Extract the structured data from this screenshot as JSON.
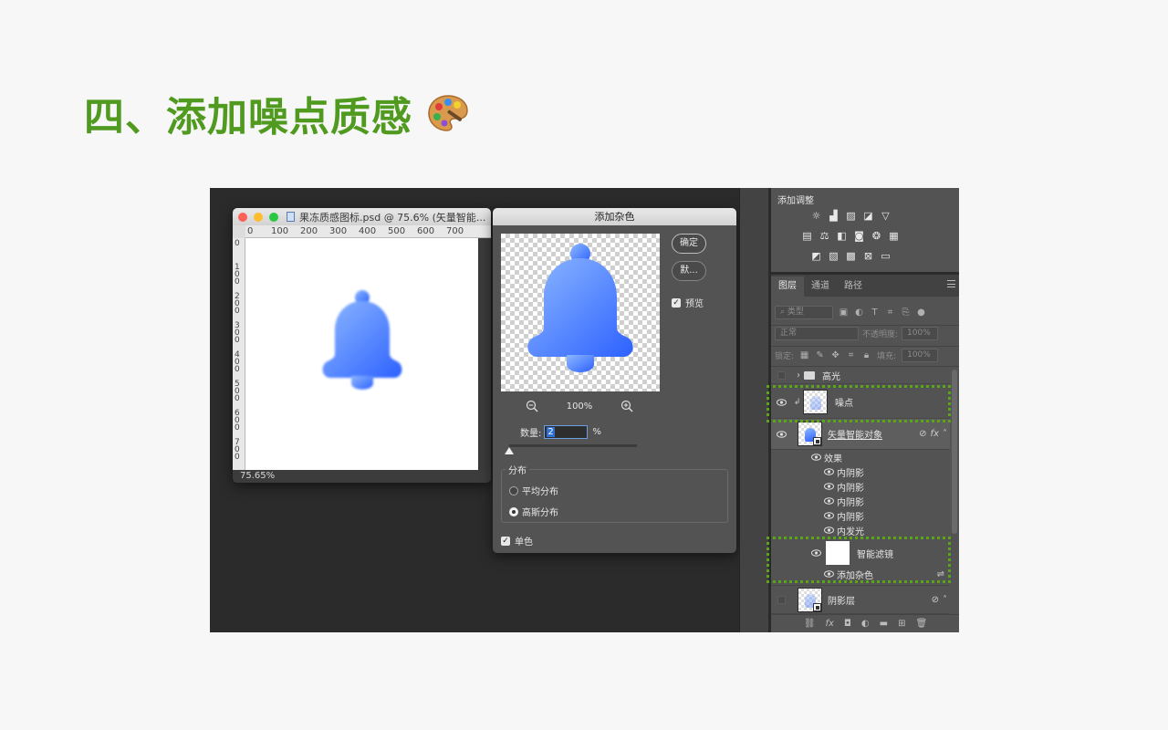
{
  "slide": {
    "title": "四、添加噪点质感",
    "title_color": "#4f9a1f",
    "title_icon": "artist-palette-icon"
  },
  "document": {
    "title": "果冻质感图标.psd @ 75.6% (矢量智能...",
    "zoom_status": "75.65%",
    "ruler_top": [
      "0",
      "100",
      "200",
      "300",
      "400",
      "500",
      "600",
      "700"
    ],
    "ruler_left": [
      "0",
      "100",
      "200",
      "300",
      "400",
      "500",
      "600",
      "700"
    ],
    "bell_gradient": [
      "#8db8ff",
      "#2d61ff"
    ]
  },
  "dialog": {
    "title": "添加杂色",
    "ok_label": "确定",
    "default_label": "默...",
    "preview_label": "预览",
    "preview_checked": true,
    "zoom_value": "100%",
    "amount_label": "数量:",
    "amount_value": "2",
    "amount_unit": "%",
    "distribution_label": "分布",
    "uniform_label": "平均分布",
    "gaussian_label": "高斯分布",
    "selected_distribution": "高斯分布",
    "mono_label": "单色",
    "mono_checked": true
  },
  "adjustments": {
    "title": "添加调整",
    "row1_icons": [
      "brightness-contrast-icon",
      "levels-icon",
      "curves-icon",
      "exposure-icon",
      "vibrance-icon"
    ],
    "row2_icons": [
      "hue-saturation-icon",
      "color-balance-icon",
      "black-white-icon",
      "photo-filter-icon",
      "channel-mixer-icon",
      "color-lookup-icon"
    ],
    "row3_icons": [
      "invert-icon",
      "posterize-icon",
      "threshold-icon",
      "selective-color-icon",
      "gradient-map-icon"
    ]
  },
  "layers_panel": {
    "tabs": [
      "图层",
      "通道",
      "路径"
    ],
    "active_tab": "图层",
    "filter_kind": "类型",
    "blend_mode": "正常",
    "opacity_label": "不透明度:",
    "opacity_value": "100%",
    "lock_label": "锁定:",
    "fill_label": "填充:",
    "fill_value": "100%",
    "layers": {
      "group_highlight": "高光",
      "noise": "噪点",
      "smart_object": "矢量智能对象",
      "effects": "效果",
      "effect_items": [
        "内阴影",
        "内阴影",
        "内阴影",
        "内阴影",
        "内发光"
      ],
      "smart_filters": "智能滤镜",
      "add_noise_filter": "添加杂色",
      "shadow": "阴影层"
    },
    "highlight_color": "#59a617"
  }
}
